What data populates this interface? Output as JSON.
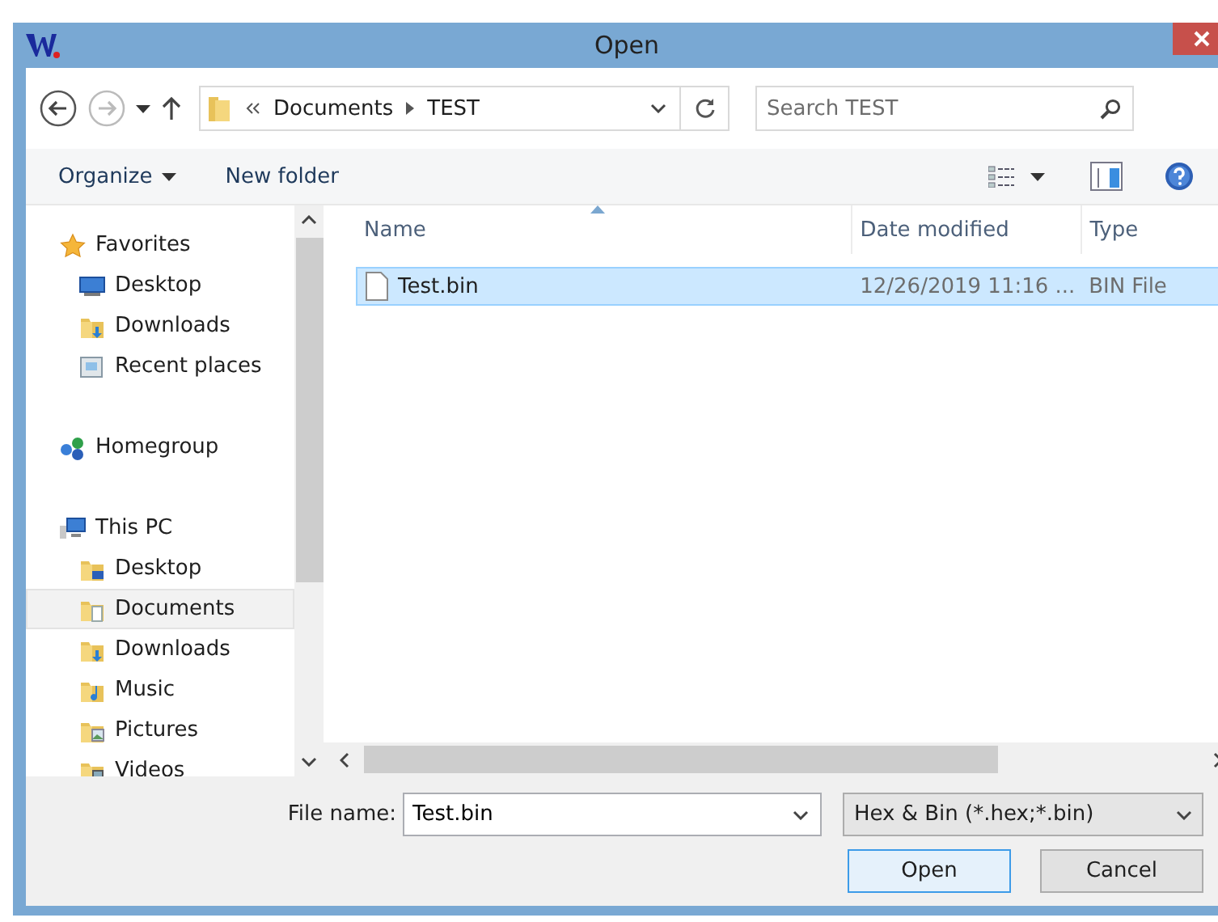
{
  "window": {
    "title": "Open"
  },
  "nav": {
    "path": [
      "Documents",
      "TEST"
    ],
    "search_placeholder": "Search TEST"
  },
  "toolbar": {
    "organize": "Organize",
    "new_folder": "New folder"
  },
  "sidebar": [
    {
      "label": "Favorites",
      "kind": "star",
      "selected": false,
      "children": [
        {
          "label": "Desktop",
          "kind": "desktop",
          "selected": false
        },
        {
          "label": "Downloads",
          "kind": "downloads",
          "selected": false
        },
        {
          "label": "Recent places",
          "kind": "recent",
          "selected": false
        }
      ]
    },
    {
      "label": "Homegroup",
      "kind": "homegroup",
      "selected": false
    },
    {
      "label": "This PC",
      "kind": "pc",
      "selected": false,
      "children": [
        {
          "label": "Desktop",
          "kind": "desktop-folder",
          "selected": false
        },
        {
          "label": "Documents",
          "kind": "documents",
          "selected": true
        },
        {
          "label": "Downloads",
          "kind": "downloads",
          "selected": false
        },
        {
          "label": "Music",
          "kind": "music",
          "selected": false
        },
        {
          "label": "Pictures",
          "kind": "pictures",
          "selected": false
        },
        {
          "label": "Videos",
          "kind": "videos",
          "selected": false
        }
      ]
    }
  ],
  "columns": [
    "Name",
    "Date modified",
    "Type"
  ],
  "rows": [
    {
      "cells": [
        "Test.bin",
        "12/26/2019 11:16 ...",
        "BIN File"
      ],
      "selected": true
    }
  ],
  "file_name": {
    "label": "File name:",
    "value": "Test.bin"
  },
  "file_type": "Hex & Bin (*.hex;*.bin)",
  "buttons": [
    {
      "label": "Open",
      "default": true
    },
    {
      "label": "Cancel",
      "default": false
    }
  ]
}
